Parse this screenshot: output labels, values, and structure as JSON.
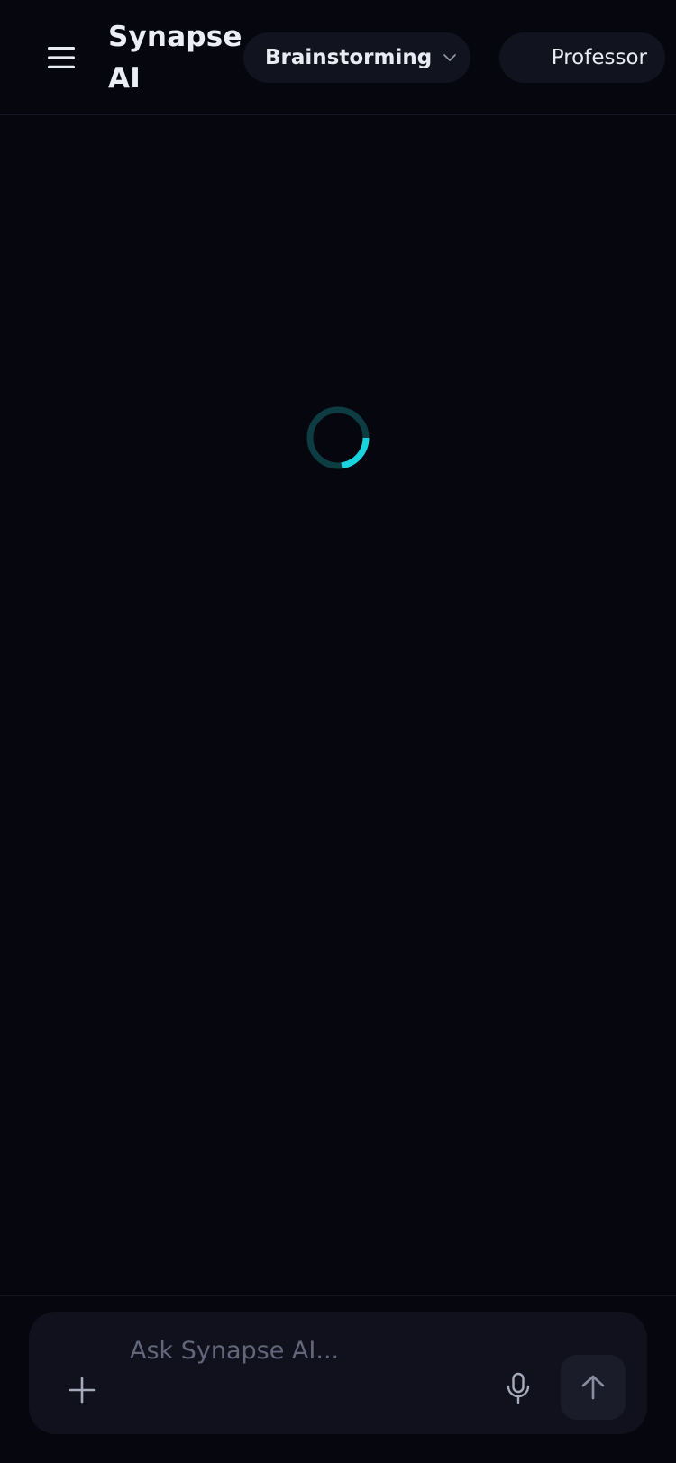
{
  "header": {
    "title": "Synapse AI",
    "mode": {
      "selected": "Brainstorming"
    },
    "persona": {
      "selected": "Professor"
    }
  },
  "main": {
    "loading_indicator": "spinner-icon"
  },
  "composer": {
    "placeholder": "Ask Synapse AI...",
    "value": ""
  },
  "icons": {
    "menu": "hamburger-menu-icon",
    "chevron": "chevron-down-icon",
    "attach": "plus-icon",
    "mic": "microphone-icon",
    "send": "arrow-up-icon"
  },
  "colors": {
    "background": "#06070e",
    "surface": "#11131e",
    "accent": "#19d3df",
    "accent_track": "#0d3c42",
    "text": "#eceef5",
    "muted": "#63667a"
  }
}
